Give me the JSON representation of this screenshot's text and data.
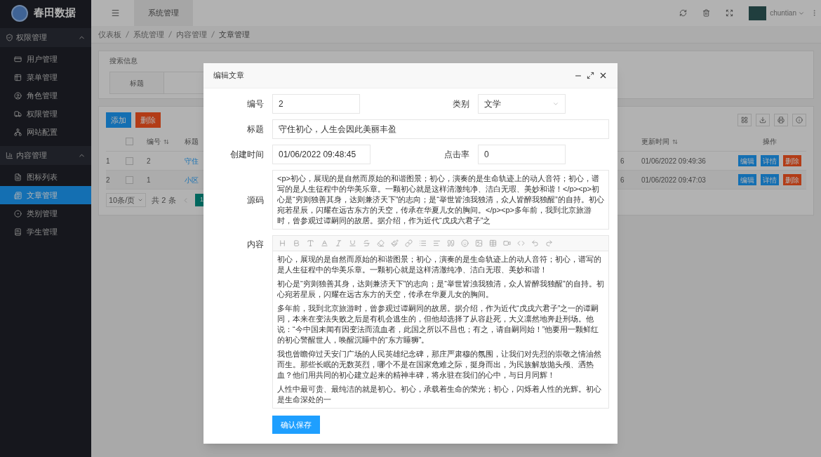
{
  "brand": {
    "name": "春田数据"
  },
  "header": {
    "tabs": [
      {
        "label": "系统管理",
        "selected": true
      }
    ],
    "user": "chuntian"
  },
  "breadcrumb": [
    "仪表板",
    "系统管理",
    "内容管理",
    "文章管理"
  ],
  "sidebar": [
    {
      "label": "权限管理",
      "expanded": true,
      "items": [
        {
          "label": "用户管理",
          "selected": false
        },
        {
          "label": "菜单管理",
          "selected": false
        },
        {
          "label": "角色管理",
          "selected": false
        },
        {
          "label": "权限管理",
          "selected": false
        },
        {
          "label": "网站配置",
          "selected": false
        }
      ]
    },
    {
      "label": "内容管理",
      "expanded": true,
      "items": [
        {
          "label": "图标列表",
          "selected": false
        },
        {
          "label": "文章管理",
          "selected": true
        },
        {
          "label": "类别管理",
          "selected": false
        },
        {
          "label": "学生管理",
          "selected": false
        }
      ]
    }
  ],
  "search": {
    "title": "搜索信息",
    "field_label": "标题"
  },
  "actions": [
    {
      "label": "添加",
      "kind": "primary"
    },
    {
      "label": "删除",
      "kind": "danger"
    }
  ],
  "table": {
    "select_all_checked": false,
    "columns": [
      {
        "label": "编号",
        "sortable": true
      },
      {
        "label": "标题",
        "sortable": false
      },
      {
        "label": "更新时间",
        "sortable": true
      },
      {
        "label": "操作",
        "sortable": false
      }
    ],
    "rows": [
      {
        "index": "1",
        "checked": false,
        "id": "2",
        "title": "守住",
        "column_5": "6",
        "updated": "01/06/2022 09:49:36",
        "actions": [
          {
            "label": "编辑",
            "kind": "primary"
          },
          {
            "label": "详情",
            "kind": "primary"
          },
          {
            "label": "删除",
            "kind": "danger"
          }
        ]
      },
      {
        "index": "2",
        "checked": false,
        "id": "1",
        "title": "小区",
        "column_5": "6",
        "updated": "01/06/2022 09:47:03",
        "actions": [
          {
            "label": "编辑",
            "kind": "primary"
          },
          {
            "label": "详情",
            "kind": "primary"
          },
          {
            "label": "删除",
            "kind": "danger"
          }
        ]
      }
    ]
  },
  "pagination": {
    "page_size": "10条/页",
    "total": "共 2 条",
    "pages": [
      {
        "label": "1",
        "selected": true
      }
    ]
  },
  "modal": {
    "title": "编辑文章",
    "id_field": {
      "label": "编号",
      "value": "2"
    },
    "category": {
      "label": "类别",
      "value": "文学"
    },
    "title_field": {
      "label": "标题",
      "value": "守住初心，人生会因此美丽丰盈"
    },
    "created": {
      "label": "创建时间",
      "value": "01/06/2022 09:48:45"
    },
    "clicks": {
      "label": "点击率",
      "value": "0"
    },
    "source": {
      "label": "源码",
      "value": "<p>初心，展现的是自然而原始的和谐图景；初心，演奏的是生命轨迹上的动人音符；初心，谱写的是人生征程中的华美乐章。一颗初心就是这样清澈纯净、洁白无瑕、美妙和谐！</p><p>初心是“穷则独善其身，达则兼济天下”的志向；是“举世皆浊我独清，众人皆醉我独醒”的自持。初心宛若星辰，闪耀在远古东方的天空，传承在华夏儿女的胸间。</p><p>多年前，我到北京旅游时，曾参观过谭嗣同的故居。据介绍，作为近代“戊戌六君子”之"
    },
    "content": {
      "label": "内容",
      "paragraphs": [
        "初心，展现的是自然而原始的和谐图景；初心，演奏的是生命轨迹上的动人音符；初心，谱写的是人生征程中的华美乐章。一颗初心就是这样清澈纯净、洁白无瑕、美妙和谐！",
        "初心是“穷则独善其身，达则兼济天下”的志向；是“举世皆浊我独清，众人皆醉我独醒”的自持。初心宛若星辰，闪耀在远古东方的天空，传承在华夏儿女的胸间。",
        "多年前，我到北京旅游时，曾参观过谭嗣同的故居。据介绍，作为近代“戊戌六君子”之一的谭嗣同，本来在变法失败之后是有机会逃生的，但他却选择了从容赴死，大义凛然地奔赴刑场。他说：“今中国未闻有因变法而流血者，此国之所以不昌也；有之，请自嗣同始！”他要用一颗鲜红的初心警醒世人，唤醒沉睡中的“东方睡狮”。",
        "我也曾瞻仰过天安门广场的人民英雄纪念碑，那庄严肃穆的氛围，让我们对先烈的崇敬之情油然而生。那些长眠的无数英烈，哪个不是在国家危难之际，挺身而出，为民族解放抛头颅、洒热血？他们用共同的初心建立起来的精神丰碑，将永驻在我们的心中，与日月同辉！",
        "人性中最可贵、最纯洁的就是初心。初心，承载着生命的荣光；初心，闪烁着人性的光辉。初心是生命深处的一"
      ]
    },
    "save_button": "确认保存"
  }
}
